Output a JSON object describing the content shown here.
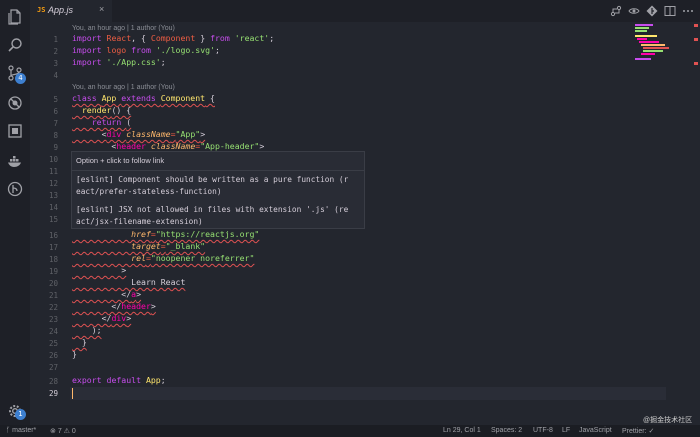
{
  "tab": {
    "label": "App.js",
    "icon": "js-icon",
    "close": "×"
  },
  "blame": {
    "line1": "You, an hour ago | 1 author (You)",
    "line5": "You, an hour ago | 1 author (You)"
  },
  "line_numbers": [
    "1",
    "2",
    "3",
    "4",
    "5",
    "6",
    "7",
    "8",
    "9",
    "10",
    "11",
    "12",
    "13",
    "14",
    "15",
    "16",
    "17",
    "18",
    "19",
    "20",
    "21",
    "22",
    "23",
    "24",
    "25",
    "26",
    "27",
    "28",
    "29"
  ],
  "code": {
    "l1": {
      "a": "import ",
      "b": "React",
      "c": ", { ",
      "d": "Component",
      "e": " } ",
      "f": "from ",
      "g": "'react'",
      "h": ";"
    },
    "l2": {
      "a": "import ",
      "b": "logo ",
      "c": "from ",
      "d": "'./logo.svg'",
      "e": ";"
    },
    "l3": {
      "a": "import ",
      "b": "'./App.css'",
      "c": ";"
    },
    "l5": {
      "a": "class ",
      "b": "App ",
      "c": "extends ",
      "d": "Component",
      "e": " {"
    },
    "l6": {
      "a": "  render",
      "b": "() {"
    },
    "l7": {
      "a": "    return ",
      "b": "("
    },
    "l8": {
      "a": "      <",
      "b": "div ",
      "c": "className",
      "d": "=",
      "e": "\"App\"",
      "f": ">"
    },
    "l9": {
      "a": "        <",
      "b": "header ",
      "c": "className",
      "d": "=",
      "e": "\"App-header\"",
      "f": ">"
    },
    "l16": {
      "a": "            href",
      "b": "=",
      "c": "\"https://reactjs.org\""
    },
    "l17": {
      "a": "            target",
      "b": "=",
      "c": "\"_blank\""
    },
    "l18": {
      "a": "            rel",
      "b": "=",
      "c": "\"noopener noreferrer\""
    },
    "l19": {
      "a": "          >"
    },
    "l20": {
      "a": "            Learn React"
    },
    "l21": {
      "a": "          </",
      "b": "a",
      "c": ">"
    },
    "l22": {
      "a": "        </",
      "b": "header",
      "c": ">"
    },
    "l23": {
      "a": "      </",
      "b": "div",
      "c": ">"
    },
    "l24": {
      "a": "    );"
    },
    "l25": {
      "a": "  }"
    },
    "l26": {
      "a": "}"
    },
    "l28": {
      "a": "export ",
      "b": "default ",
      "c": "App",
      "d": ";"
    }
  },
  "hover": {
    "follow": "Option + click to follow link",
    "msg1_a": "[eslint] Component should be written as a pure function (r",
    "msg1_b": "eact/prefer-stateless-function)",
    "msg2_a": "[eslint] JSX not allowed in files with extension '.js' (re",
    "msg2_b": "act/jsx-filename-extension)"
  },
  "activity": {
    "items": [
      "files-icon",
      "search-icon",
      "source-control-icon",
      "debug-icon",
      "extensions-icon",
      "docker-icon",
      "git-history-icon"
    ],
    "scm_badge": "4",
    "settings_badge": "1"
  },
  "toolbar": [
    "git-compare-icon",
    "open-changes-icon",
    "git-graph-icon",
    "split-editor-icon",
    "more-icon"
  ],
  "status": {
    "branch": "master*",
    "errors": "7",
    "warnings": "0",
    "position": "Ln 29, Col 1",
    "spaces": "Spaces: 2",
    "encoding": "UTF-8",
    "eol": "LF",
    "language": "JavaScript",
    "prettier": "Prettier: ✓",
    "watermark": "@掘金技术社区"
  },
  "colors": {
    "background": "#23262e",
    "keyword": "#c74ded",
    "class": "#ffe66d",
    "string": "#96e072",
    "tag": "#ff00aa",
    "attribute": "#ffb86c",
    "error": "#e05252"
  }
}
